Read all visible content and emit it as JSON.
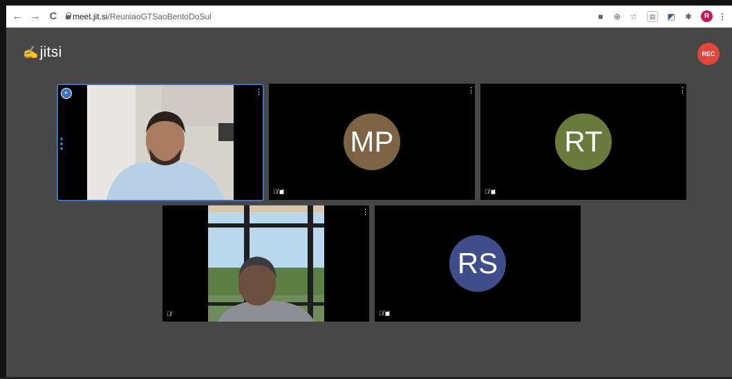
{
  "browser": {
    "back_icon": "←",
    "forward_icon": "→",
    "reload_icon": "C",
    "url_host": "meet.jit.si",
    "url_path": "/ReuniaoGTSaoBentoDoSul",
    "profile_initial": "R"
  },
  "app": {
    "logo_text": "jitsi",
    "rec_label": "REC"
  },
  "participants": [
    {
      "kind": "video",
      "active": true,
      "label": ""
    },
    {
      "kind": "avatar",
      "initials": "MP",
      "color": "#7d6243"
    },
    {
      "kind": "avatar",
      "initials": "RT",
      "color": "#6a7a3c"
    },
    {
      "kind": "video",
      "active": false,
      "label": ""
    },
    {
      "kind": "avatar",
      "initials": "RS",
      "color": "#3f4d8a"
    }
  ],
  "colors": {
    "stage_bg": "#474747",
    "active_border": "#3d72c4",
    "rec": "#e2453c"
  }
}
